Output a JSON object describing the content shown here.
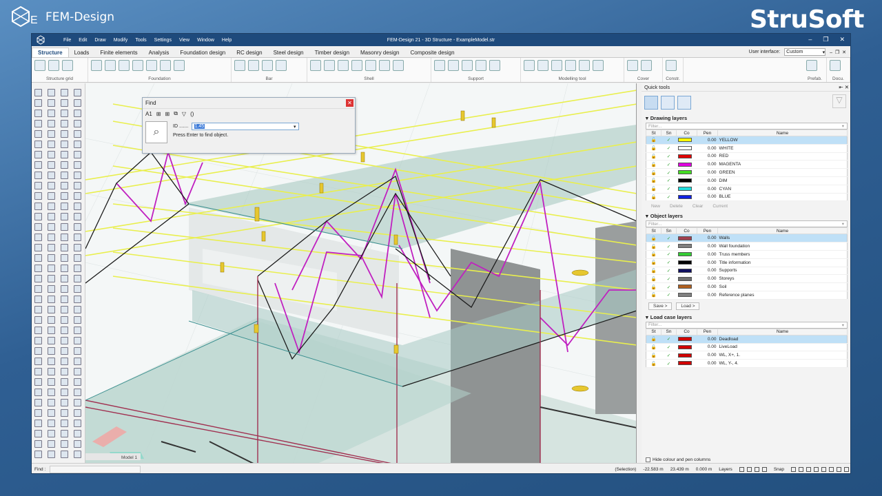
{
  "brand": {
    "left": "FEM-Design",
    "right": "StruSoft"
  },
  "window": {
    "title": "FEM-Design 21 - 3D Structure - ExampleModel.str",
    "menu": [
      "File",
      "Edit",
      "Draw",
      "Modify",
      "Tools",
      "Settings",
      "View",
      "Window",
      "Help"
    ],
    "controls": [
      "–",
      "❐",
      "✕"
    ]
  },
  "tabs": [
    "Structure",
    "Loads",
    "Finite elements",
    "Analysis",
    "Foundation design",
    "RC design",
    "Steel design",
    "Timber design",
    "Masonry design",
    "Composite design"
  ],
  "user_interface": {
    "label": "User interface:",
    "value": "Custom"
  },
  "ribbon_groups": [
    "Structure grid",
    "Foundation",
    "Bar",
    "Shell",
    "Support",
    "Modelling tool",
    "Cover",
    "Constr.",
    "Prefab.",
    "Docu."
  ],
  "find_dialog": {
    "title": "Find",
    "tools": [
      "A1",
      "⊞",
      "⊞",
      "⧉",
      "▽",
      "()"
    ],
    "id_label": "ID .......",
    "id_value": "1.45",
    "hint": "Press Enter to find object."
  },
  "viewport": {
    "tab_label": "Model 1"
  },
  "quick_tools": {
    "title": "Quick tools",
    "header_icons": "⇤ ✕",
    "filter_placeholder": "Filter...",
    "columns": [
      "St",
      "Sn",
      "Co",
      "Pen",
      "Name"
    ],
    "drawing_layers": {
      "title": "Drawing layers",
      "rows": [
        {
          "pen": "0.00",
          "name": "YELLOW",
          "color": "#ffff00"
        },
        {
          "pen": "0.00",
          "name": "WHITE",
          "color": "#ffffff"
        },
        {
          "pen": "0.00",
          "name": "RED",
          "color": "#e00000"
        },
        {
          "pen": "0.00",
          "name": "MAGENTA",
          "color": "#e000e0"
        },
        {
          "pen": "0.00",
          "name": "GREEN",
          "color": "#44dd22"
        },
        {
          "pen": "0.00",
          "name": "DIM",
          "color": "#000000"
        },
        {
          "pen": "0.00",
          "name": "CYAN",
          "color": "#22dddd"
        },
        {
          "pen": "0.00",
          "name": "BLUE",
          "color": "#1020e0"
        }
      ],
      "buttons": [
        "New",
        "Delete",
        "Clear",
        "Current"
      ]
    },
    "object_layers": {
      "title": "Object layers",
      "rows": [
        {
          "pen": "0.00",
          "name": "Walls",
          "color": "#a04050"
        },
        {
          "pen": "0.00",
          "name": "Wall foundation",
          "color": "#808080"
        },
        {
          "pen": "0.00",
          "name": "Truss members",
          "color": "#33cc33"
        },
        {
          "pen": "0.00",
          "name": "Title information",
          "color": "#000000"
        },
        {
          "pen": "0.00",
          "name": "Supports",
          "color": "#101060"
        },
        {
          "pen": "0.00",
          "name": "Storeys",
          "color": "#707070"
        },
        {
          "pen": "0.00",
          "name": "Soil",
          "color": "#b06020"
        },
        {
          "pen": "0.00",
          "name": "Reference planes",
          "color": "#808080"
        }
      ],
      "buttons": [
        "Save >",
        "Load >"
      ]
    },
    "load_case_layers": {
      "title": "Load case layers",
      "rows": [
        {
          "pen": "0.00",
          "name": "Deadload",
          "color": "#d00000"
        },
        {
          "pen": "0.00",
          "name": "LiveLoad",
          "color": "#d00000"
        },
        {
          "pen": "0.00",
          "name": "WL, X+, 1.",
          "color": "#d00000"
        },
        {
          "pen": "0.00",
          "name": "WL, Y-, 4.",
          "color": "#d00000"
        }
      ]
    },
    "hide_columns_label": "Hide colour and pen columns"
  },
  "status": {
    "find_label": "Find :",
    "selection": "(Selection)",
    "x": "-22.583 m",
    "y": "23.439 m",
    "z": "0.000 m",
    "layers": "Layers",
    "snap": "Snap"
  }
}
